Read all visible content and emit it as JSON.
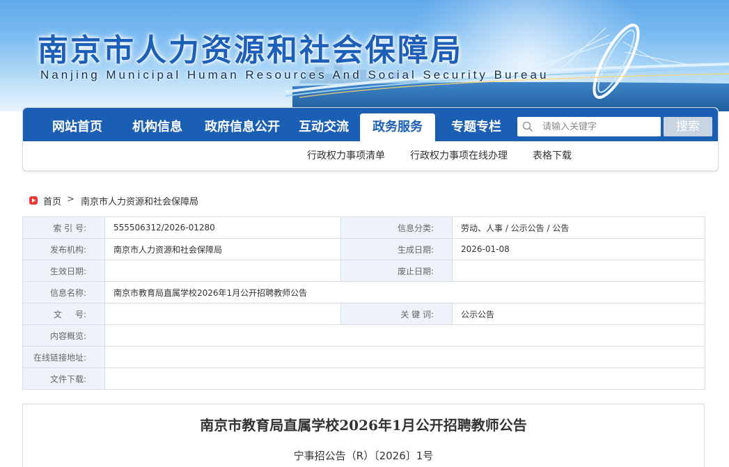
{
  "header": {
    "site_title": "南京市人力资源和社会保障局",
    "site_subtitle": "Nanjing Municipal Human Resources And Social Security Bureau"
  },
  "nav": {
    "items": [
      {
        "label": "网站首页"
      },
      {
        "label": "机构信息"
      },
      {
        "label": "政府信息公开"
      },
      {
        "label": "互动交流"
      },
      {
        "label": "政务服务",
        "active": true
      },
      {
        "label": "专题专栏"
      }
    ],
    "search_placeholder": "请输入关键字",
    "search_button": "搜索",
    "sub_items": [
      {
        "label": "行政权力事项清单"
      },
      {
        "label": "行政权力事项在线办理"
      },
      {
        "label": "表格下载"
      }
    ]
  },
  "breadcrumb": {
    "home": "首页",
    "separator": ">",
    "current": "南京市人力资源和社会保障局"
  },
  "info_table": {
    "index_label": "索 引 号:",
    "index_value": "555506312/2026-01280",
    "category_label": "信息分类:",
    "category_value": "劳动、人事 / 公示公告 / 公告",
    "publisher_label": "发布机构:",
    "publisher_value": "南京市人力资源和社会保障局",
    "created_label": "生成日期:",
    "created_value": "2026-01-08",
    "effective_label": "生效日期:",
    "effective_value": "",
    "expiry_label": "废止日期:",
    "expiry_value": "",
    "name_label": "信息名称:",
    "name_value": "南京市教育局直属学校2026年1月公开招聘教师公告",
    "docno_label": "文     号:",
    "docno_value": "",
    "keywords_label": "关 键 词:",
    "keywords_value": "公示公告",
    "overview_label": "内容概览:",
    "overview_value": "",
    "link_label": "在线链接地址:",
    "link_value": "",
    "download_label": "文件下载:",
    "download_value": ""
  },
  "article": {
    "title": "南京市教育局直属学校2026年1月公开招聘教师公告",
    "doc_number": "宁事招公告（R）〔2026〕1号"
  },
  "colors": {
    "nav_blue": "#1a5fb4",
    "label_bg": "#eef3f9",
    "search_button_bg": "#c9d4e3"
  }
}
